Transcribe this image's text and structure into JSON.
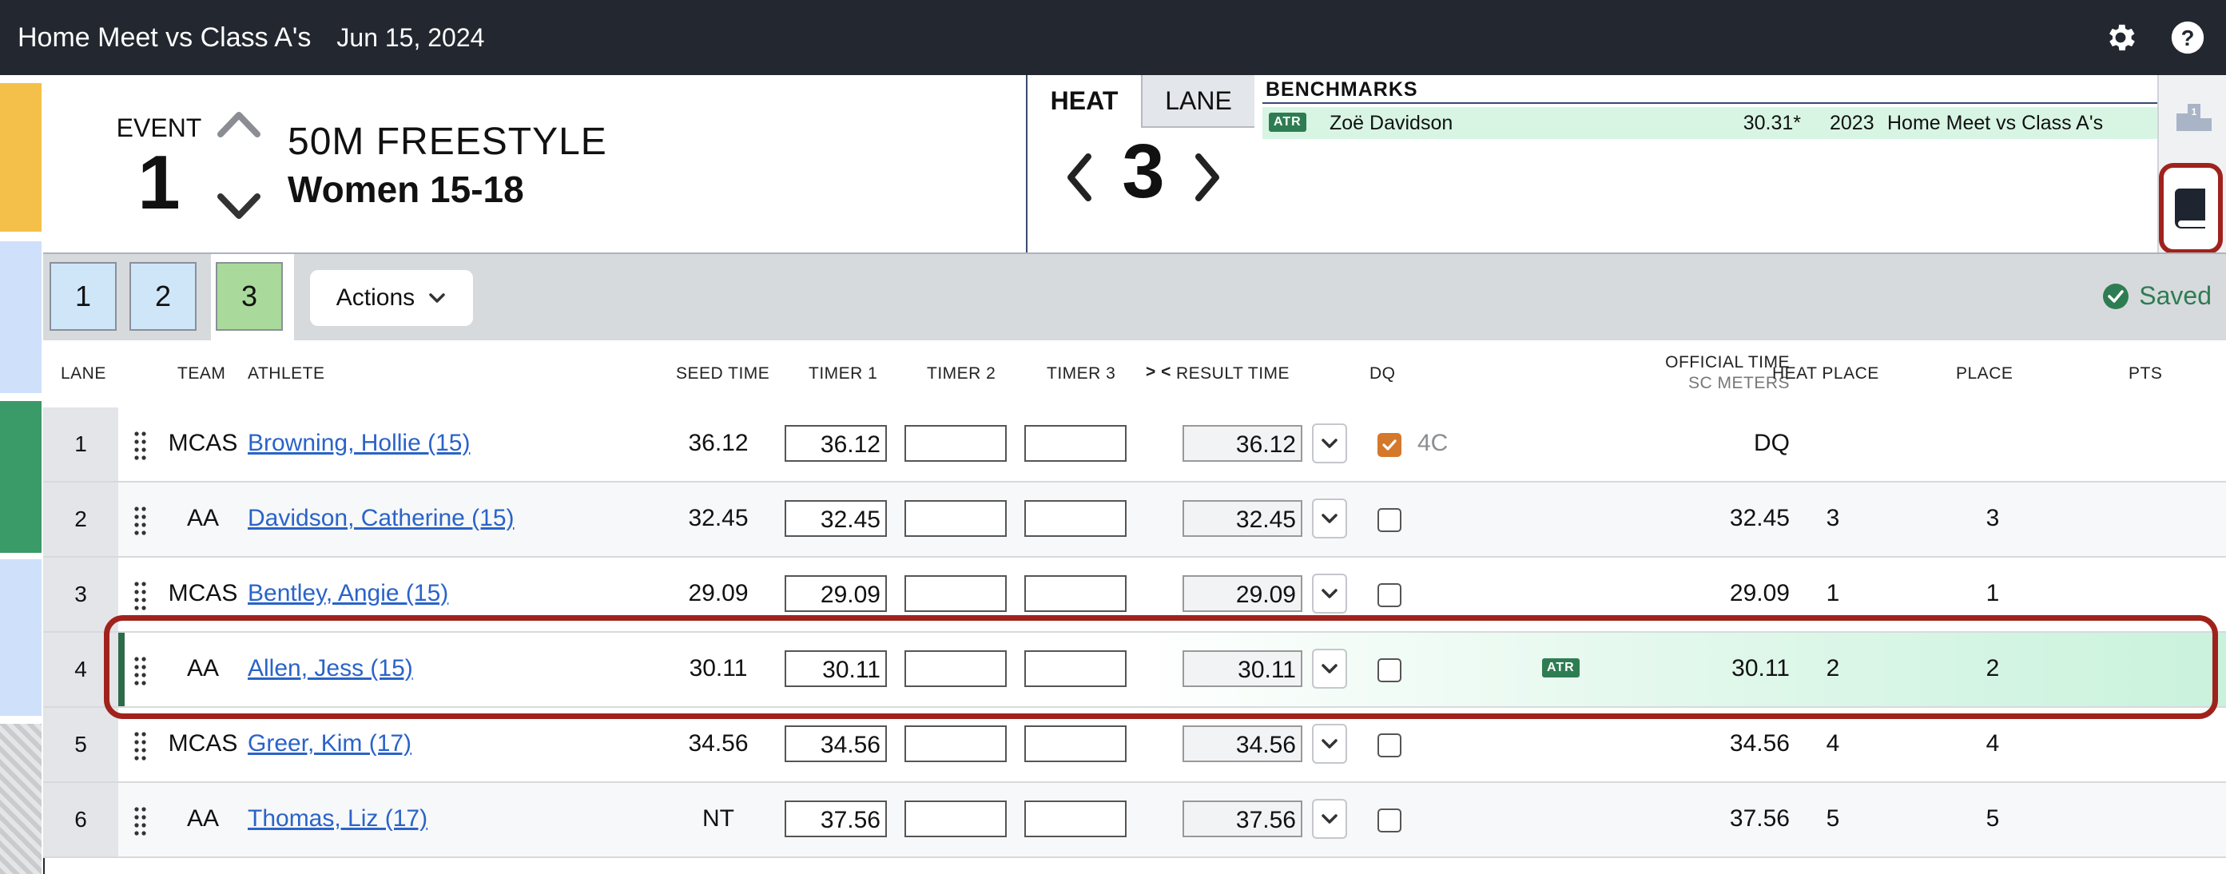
{
  "header": {
    "meet_title": "Home Meet vs Class A's",
    "date": "Jun 15, 2024",
    "icons": [
      "gear-icon",
      "help-icon"
    ]
  },
  "event": {
    "label": "EVENT",
    "number": "1",
    "name": "50M FREESTYLE",
    "group": "Women 15-18"
  },
  "heat_panel": {
    "tab_heat": "HEAT",
    "tab_lane": "LANE",
    "heat_number": "3"
  },
  "benchmarks": {
    "title": "BENCHMARKS",
    "rows": [
      {
        "badge": "ATR",
        "name": "Zoë Davidson",
        "time": "30.31*",
        "year": "2023",
        "meet": "Home Meet vs Class A's"
      }
    ]
  },
  "heat_tabs": [
    "1",
    "2",
    "3"
  ],
  "active_heat_tab": "3",
  "actions_label": "Actions",
  "saved_label": "Saved",
  "columns": {
    "lane": "LANE",
    "team": "TEAM",
    "athlete": "ATHLETE",
    "seed_time": "SEED TIME",
    "timer1": "TIMER 1",
    "timer2": "TIMER 2",
    "timer3": "TIMER 3",
    "swap": "> <",
    "result_time": "RESULT TIME",
    "dq": "DQ",
    "official_time": "OFFICIAL TIME",
    "official_unit": "SC METERS",
    "heat_place": "HEAT PLACE",
    "place": "PLACE",
    "pts": "PTS"
  },
  "rows": [
    {
      "lane": "1",
      "team": "MCAS",
      "athlete": "Browning, Hollie (15)",
      "seed": "36.12",
      "timer1": "36.12",
      "timer2": "",
      "timer3": "",
      "result": "36.12",
      "dq": true,
      "dq_code": "4C",
      "atr": "",
      "official": "DQ",
      "heat_place": "",
      "place": "",
      "pts": ""
    },
    {
      "lane": "2",
      "team": "AA",
      "athlete": "Davidson, Catherine (15)",
      "seed": "32.45",
      "timer1": "32.45",
      "timer2": "",
      "timer3": "",
      "result": "32.45",
      "dq": false,
      "dq_code": "",
      "atr": "",
      "official": "32.45",
      "heat_place": "3",
      "place": "3",
      "pts": ""
    },
    {
      "lane": "3",
      "team": "MCAS",
      "athlete": "Bentley, Angie (15)",
      "seed": "29.09",
      "timer1": "29.09",
      "timer2": "",
      "timer3": "",
      "result": "29.09",
      "dq": false,
      "dq_code": "",
      "atr": "",
      "official": "29.09",
      "heat_place": "1",
      "place": "1",
      "pts": ""
    },
    {
      "lane": "4",
      "team": "AA",
      "athlete": "Allen, Jess (15)",
      "seed": "30.11",
      "timer1": "30.11",
      "timer2": "",
      "timer3": "",
      "result": "30.11",
      "dq": false,
      "dq_code": "",
      "atr": "ATR",
      "official": "30.11",
      "heat_place": "2",
      "place": "2",
      "pts": ""
    },
    {
      "lane": "5",
      "team": "MCAS",
      "athlete": "Greer, Kim (17)",
      "seed": "34.56",
      "timer1": "34.56",
      "timer2": "",
      "timer3": "",
      "result": "34.56",
      "dq": false,
      "dq_code": "",
      "atr": "",
      "official": "34.56",
      "heat_place": "4",
      "place": "4",
      "pts": ""
    },
    {
      "lane": "6",
      "team": "AA",
      "athlete": "Thomas, Liz (17)",
      "seed": "NT",
      "timer1": "37.56",
      "timer2": "",
      "timer3": "",
      "result": "37.56",
      "dq": false,
      "dq_code": "",
      "atr": "",
      "official": "37.56",
      "heat_place": "5",
      "place": "5",
      "pts": ""
    }
  ],
  "highlighted_lane": "4",
  "colors": {
    "topbar": "#23272f",
    "accent_green": "#2e7d52",
    "highlight_border": "#a0221c",
    "dq_orange": "#d4782c",
    "link_blue": "#2a63c9"
  }
}
